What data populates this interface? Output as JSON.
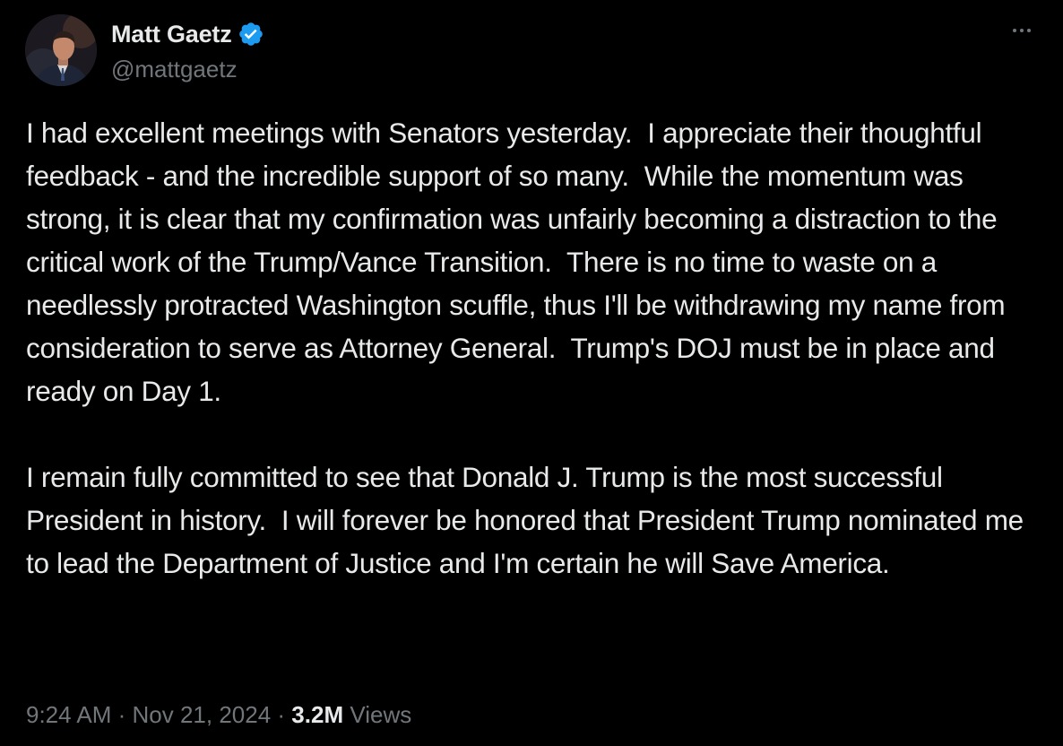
{
  "author": {
    "display_name": "Matt Gaetz",
    "handle": "@mattgaetz",
    "verified_icon": "verified-badge-icon",
    "avatar": "profile-photo"
  },
  "more_menu": {
    "icon": "more-options-icon"
  },
  "tweet": {
    "paragraphs": [
      "I had excellent meetings with Senators yesterday.  I appreciate their thoughtful feedback - and the incredible support of so many.  While the momentum was strong, it is clear that my confirmation was unfairly becoming a distraction to the critical work of the Trump/Vance Transition.  There is no time to waste on a needlessly protracted Washington scuffle, thus I'll be withdrawing my name from consideration to serve as Attorney General.  Trump's DOJ must be in place and ready on Day 1.",
      "I remain fully committed to see that Donald J. Trump is the most successful President in history.  I will forever be honored that President Trump nominated me to lead the Department of Justice and I'm certain he will Save America."
    ]
  },
  "meta": {
    "time": "9:24 AM",
    "separator": " · ",
    "date": "Nov 21, 2024",
    "views_count": "3.2M",
    "views_label": "Views"
  },
  "colors": {
    "background": "#000000",
    "text_primary": "#e7e9ea",
    "text_secondary": "#71767b",
    "verified_blue": "#1d9bf0"
  }
}
